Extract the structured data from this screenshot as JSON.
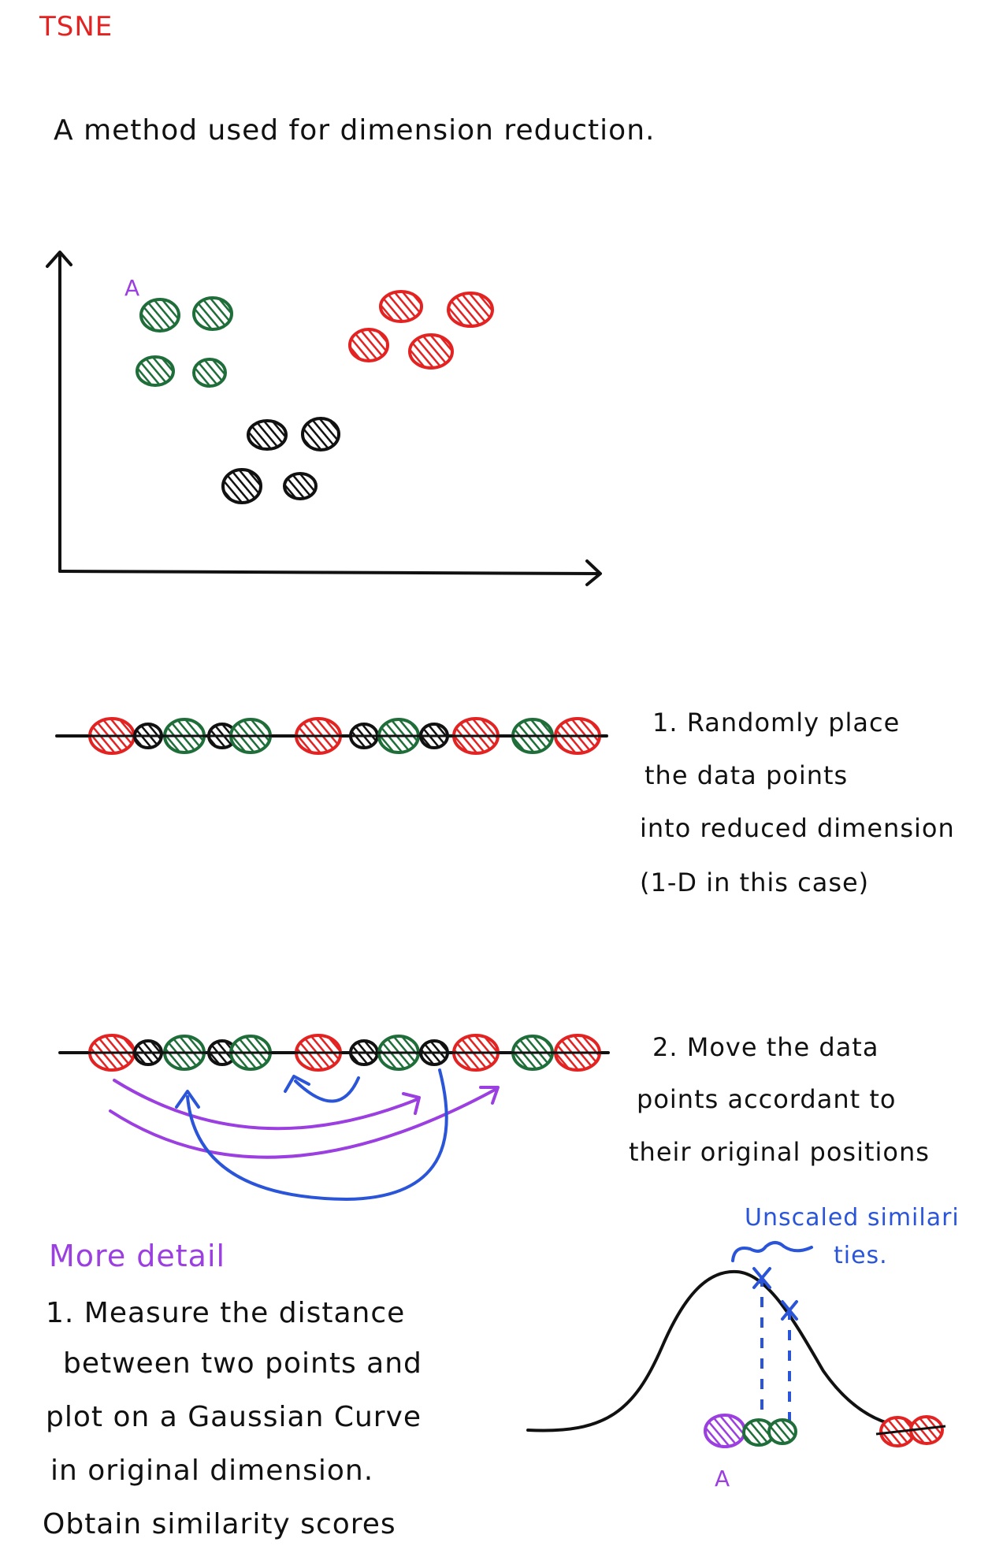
{
  "title": "TSNE",
  "intro": "A method used for dimension reduction.",
  "colors": {
    "red": "#e32222",
    "green": "#1f6e3a",
    "black": "#111111",
    "purple": "#9b3fe0",
    "blue": "#2a55d8"
  },
  "scatter": {
    "point_label": "A",
    "clusters": [
      {
        "color": "green",
        "count": 4
      },
      {
        "color": "red",
        "count": 4
      },
      {
        "color": "black",
        "count": 4
      }
    ]
  },
  "line_points_order": [
    "red",
    "black",
    "green",
    "black",
    "green",
    "red",
    "black",
    "green",
    "black",
    "red",
    "green",
    "red"
  ],
  "step1": {
    "lines": [
      "1. Randomly place",
      "the data points",
      "into reduced dimension",
      "(1-D in this case)"
    ]
  },
  "step2": {
    "lines": [
      "2. Move the data",
      "points accordant to",
      "their original positions"
    ]
  },
  "more_detail": {
    "heading": "More detail",
    "lines": [
      "1. Measure the distance",
      "between two points and",
      "plot on a Gaussian Curve",
      "in original dimension.",
      "Obtain similarity scores"
    ]
  },
  "gaussian": {
    "annotation_line1": "Unscaled similari",
    "annotation_line2": "ties.",
    "point_label": "A"
  }
}
